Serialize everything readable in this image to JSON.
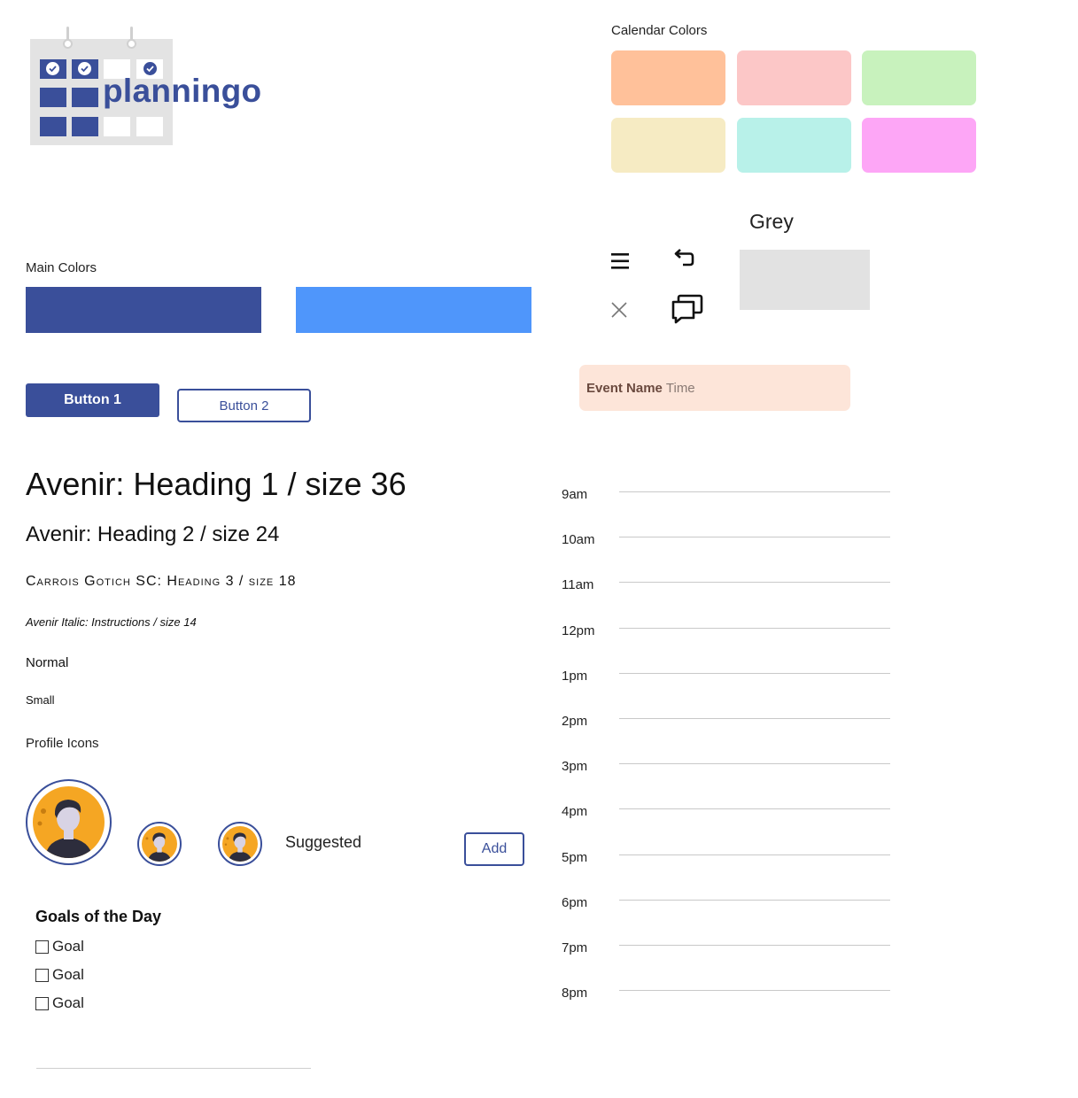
{
  "logo": {
    "text": "planningo",
    "icon": "calendar-logo-icon"
  },
  "calendar_colors": {
    "label": "Calendar Colors",
    "swatches": [
      "#ffc19a",
      "#fcc7c7",
      "#c8f2bd",
      "#f6ebc3",
      "#b8f1e9",
      "#fda6f6"
    ]
  },
  "main_colors": {
    "label": "Main Colors",
    "swatches": [
      "#3a4f9a",
      "#4f96fb"
    ]
  },
  "icons": [
    "menu-icon",
    "undo-icon",
    "close-icon",
    "chat-icon"
  ],
  "grey": {
    "label": "Grey",
    "color": "#e2e2e2"
  },
  "buttons": {
    "button1": "Button 1",
    "button2": "Button 2"
  },
  "event_card": {
    "name": "Event Name",
    "time": "Time"
  },
  "typography": {
    "h1": "Avenir: Heading 1 / size 36",
    "h2": "Avenir: Heading 2 / size 24",
    "h3": "Carrois Gotich SC: Heading 3 / size 18",
    "italic": "Avenir Italic: Instructions / size 14",
    "normal": "Normal",
    "small": "Small"
  },
  "profile": {
    "label": "Profile Icons",
    "suggested": "Suggested",
    "add": "Add"
  },
  "goals": {
    "title": "Goals of the Day",
    "items": [
      "Goal",
      "Goal",
      "Goal"
    ]
  },
  "timeline": [
    "9am",
    "10am",
    "11am",
    "12pm",
    "1pm",
    "2pm",
    "3pm",
    "4pm",
    "5pm",
    "6pm",
    "7pm",
    "8pm"
  ],
  "colors": {
    "accent": "#3a4f9a",
    "accent_light": "#4f96fb",
    "avatar_bg": "#f5a623"
  }
}
